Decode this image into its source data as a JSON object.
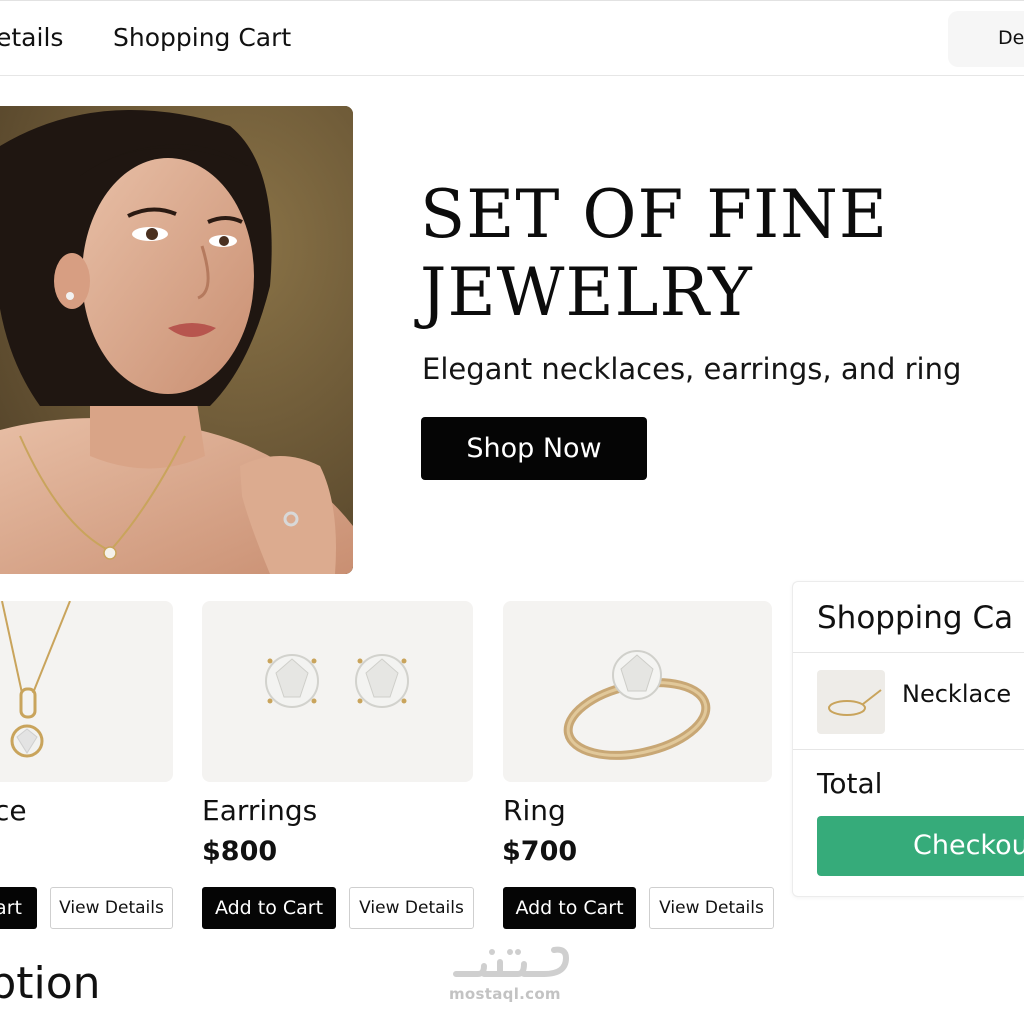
{
  "nav": {
    "details_label": "etails",
    "cart_label": "Shopping Cart",
    "pill_label": "De"
  },
  "hero": {
    "title_line1": "SET OF FINE",
    "title_line2": "JEWELRY",
    "subtitle": "Elegant necklaces, earrings, and ring",
    "cta_label": "Shop Now"
  },
  "products": [
    {
      "name": "ce",
      "price": "",
      "add_label": "art",
      "view_label": "View Details"
    },
    {
      "name": "Earrings",
      "price": "$800",
      "add_label": "Add to Cart",
      "view_label": "View Details"
    },
    {
      "name": "Ring",
      "price": "$700",
      "add_label": "Add to Cart",
      "view_label": "View Details"
    }
  ],
  "cart": {
    "title": "Shopping Ca",
    "items": [
      {
        "name": "Necklace"
      }
    ],
    "total_label": "Total",
    "checkout_label": "Checkout"
  },
  "description": {
    "heading": "ription"
  },
  "watermark": {
    "url": "mostaql.com",
    "arabic": "مستقل"
  },
  "colors": {
    "primary_button": "#050505",
    "checkout": "#36ab7a",
    "card_background": "#f4f3f1",
    "gold": "#c9a45c"
  },
  "icons": {
    "necklace_thumb": "necklace-icon"
  }
}
